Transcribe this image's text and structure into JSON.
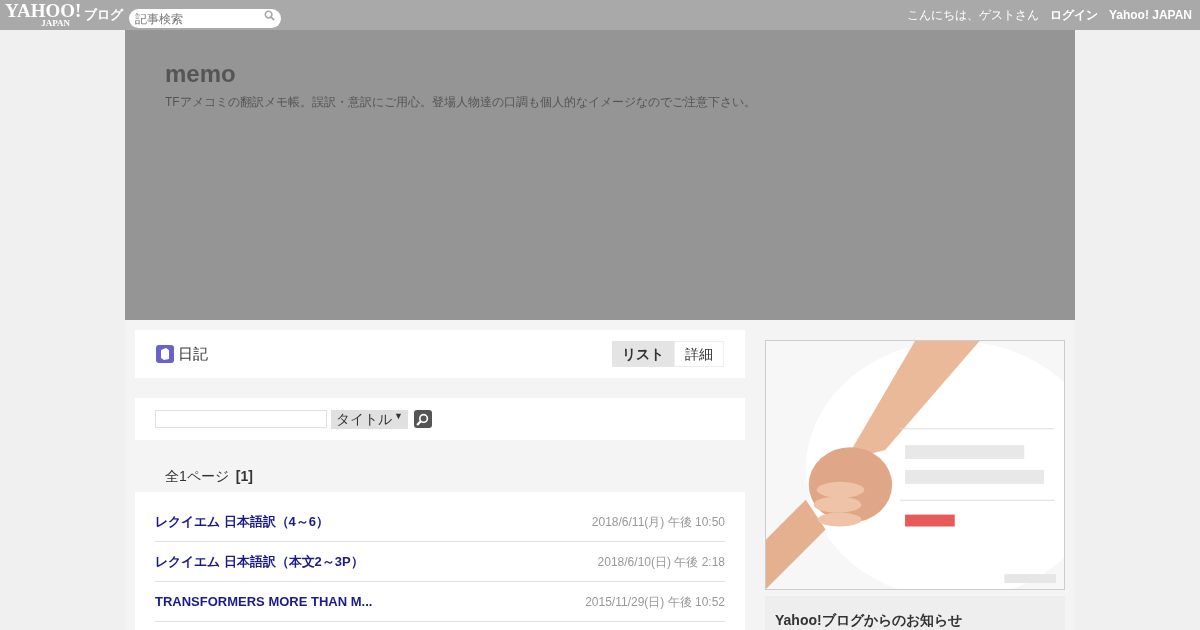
{
  "topbar": {
    "logo": "YAHOO!",
    "logo_sub": "JAPAN",
    "service": "ブログ",
    "search": {
      "placeholder": "記事検索"
    },
    "greeting": "こんにちは、ゲストさん",
    "links": [
      "ログイン",
      "Yahoo! JAPAN"
    ]
  },
  "blog": {
    "title": "memo",
    "description": "TFアメコミの翻訳メモ帳。誤訳・意訳にご用心。登場人物達の口調も個人的なイメージなのでご注意下さい。"
  },
  "category": {
    "name": "日記",
    "tabs": [
      {
        "label": "リスト",
        "selected": true
      },
      {
        "label": "詳細",
        "selected": false
      }
    ]
  },
  "article_search": {
    "mode": "タイトル",
    "arrow": "▼"
  },
  "pager": {
    "label": "全1ページ",
    "current": "[1]"
  },
  "posts": [
    {
      "title": "レクイエム 日本語訳（4～6）",
      "date": "2018/6/11(月) 午後 10:50"
    },
    {
      "title": "レクイエム 日本語訳（本文2～3P）",
      "date": "2018/6/10(日) 午後 2:18"
    },
    {
      "title": "TRANSFORMERS MORE THAN M...",
      "date": "2015/11/29(日) 午後 10:52"
    }
  ],
  "sidebar": {
    "notice_title": "Yahoo!ブログからのお知らせ"
  }
}
